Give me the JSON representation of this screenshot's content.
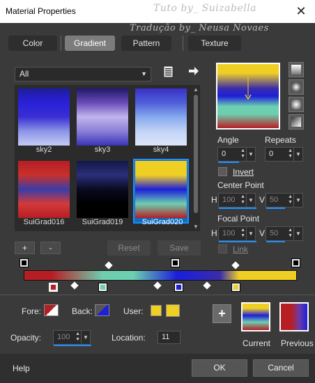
{
  "window": {
    "title": "Material Properties",
    "close_glyph": "✕"
  },
  "watermark": {
    "line1": "Tuto by_ Suizabella",
    "line2": "Tradução by_ Neusa Novaes"
  },
  "tabs": [
    {
      "label": "Color",
      "active": false
    },
    {
      "label": "Gradient",
      "active": true
    },
    {
      "label": "Pattern",
      "active": false
    },
    {
      "label": "Texture",
      "active": false
    }
  ],
  "library": {
    "category": "All",
    "items": [
      {
        "name": "sky2",
        "colors": [
          "#1d1d9e",
          "#2a20d8",
          "#3a2fd4",
          "#8c95e8",
          "#c5cbf3"
        ]
      },
      {
        "name": "sky3",
        "colors": [
          "#22186e",
          "#6a4bb6",
          "#c0b5ee",
          "#8a7ed8",
          "#3b33b8"
        ]
      },
      {
        "name": "sky4",
        "colors": [
          "#3a30c8",
          "#4f5fd8",
          "#86a9ee",
          "#c2d3f6",
          "#dce6fb"
        ]
      },
      {
        "name": "SuiGrad016",
        "colors": [
          "#b71e24",
          "#c8302c",
          "#3b3ca8",
          "#d23a3a",
          "#b71e24"
        ]
      },
      {
        "name": "SuiGrad019",
        "colors": [
          "#141846",
          "#2a2f7a",
          "#0a0a20",
          "#000000",
          "#000000"
        ]
      },
      {
        "name": "SuiGrad020",
        "colors": [
          "#f0cf24",
          "#f0cf24",
          "#1d1fd9",
          "#6dcfb0",
          "#b71e24"
        ]
      }
    ],
    "selected": "SuiGrad020"
  },
  "list_buttons": {
    "add": "+",
    "remove": "-",
    "reset": "Reset",
    "save": "Save"
  },
  "gradient_editor": {
    "angle_label": "Angle",
    "angle": "0",
    "repeats_label": "Repeats",
    "repeats": "0",
    "invert_label": "Invert",
    "invert": false,
    "center_point_label": "Center Point",
    "center_h": "100",
    "center_v": "50",
    "focal_point_label": "Focal Point",
    "focal_h": "100",
    "focal_v": "50",
    "link_label": "Link",
    "link": false,
    "h_label": "H",
    "v_label": "V"
  },
  "stops": [
    {
      "color": "#b71e24",
      "location": 11
    },
    {
      "color": "#6dcfb0",
      "location": 29
    },
    {
      "color": "#1d1fd9",
      "location": 57
    },
    {
      "color": "#f0cf24",
      "location": 79
    }
  ],
  "colors": {
    "fore_label": "Fore:",
    "back_label": "Back:",
    "user_label": "User:",
    "fore": "#b71e24",
    "back": "#1d1fd9",
    "user1": "#f0cf24",
    "user2": "#f0cf24"
  },
  "opacity": {
    "label": "Opacity:",
    "value": "100"
  },
  "location": {
    "label": "Location:",
    "value": "11"
  },
  "swatches": {
    "add": "+",
    "current_label": "Current",
    "previous_label": "Previous"
  },
  "footer": {
    "help": "Help",
    "ok": "OK",
    "cancel": "Cancel"
  }
}
